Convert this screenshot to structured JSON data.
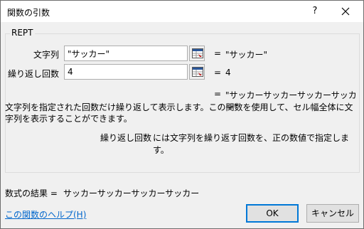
{
  "window": {
    "title": "関数の引数"
  },
  "titlebar": {
    "help_label": "?",
    "close_label": "✕"
  },
  "group": {
    "label": "REPT"
  },
  "args": [
    {
      "label": "文字列",
      "value": "\"サッカー\"",
      "eq": "=",
      "result": "\"サッカー\""
    },
    {
      "label": "繰り返し回数",
      "value": "4",
      "eq": "=",
      "result": "4"
    }
  ],
  "function_result": {
    "eq": "=",
    "value": "\"サッカーサッカーサッカーサッカー\""
  },
  "description": "文字列を指定された回数だけ繰り返して表示します。この関数を使用して、セル幅全体に文字列を表示することができます。",
  "arg_help": {
    "name": "繰り返し回数",
    "text": "には文字列を繰り返す回数を、正の数値で指定します。"
  },
  "formula_result": {
    "label": "数式の結果 =",
    "value": "サッカーサッカーサッカーサッカー"
  },
  "help_link": "この関数のヘルプ(H)",
  "buttons": {
    "ok": "OK",
    "cancel": "キャンセル"
  },
  "colors": {
    "link": "#0066cc",
    "accent": "#0078d7"
  }
}
